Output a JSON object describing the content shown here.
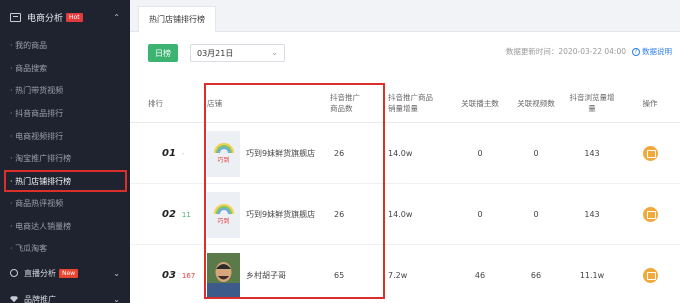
{
  "sidebar": {
    "header": {
      "label": "电商分析",
      "badge": "Hot"
    },
    "items": [
      {
        "label": "· 我的商品"
      },
      {
        "label": "· 商品搜索"
      },
      {
        "label": "· 热门带货视频"
      },
      {
        "label": "· 抖音商品排行"
      },
      {
        "label": "· 电商视频排行"
      },
      {
        "label": "· 淘宝推广排行榜"
      },
      {
        "label": "· 热门店铺排行榜"
      },
      {
        "label": "· 商品热评视频"
      },
      {
        "label": "· 电商达人销量榜"
      },
      {
        "label": "· 飞瓜淘客"
      }
    ],
    "active_index": 6,
    "groups": [
      {
        "label": "直播分析",
        "badge": "New"
      },
      {
        "label": "品牌推广"
      }
    ]
  },
  "tabbar": {
    "tab": "热门店铺排行榜"
  },
  "filters": {
    "period_button": "日榜",
    "date": "03月21日",
    "update_text": "数据更新时间：2020-03-22 04:00",
    "help_text": "数据说明"
  },
  "table": {
    "headers": {
      "rank": "排行",
      "shop": "店铺",
      "promo_count": "抖音推广\n商品数",
      "sales_increase": "抖音推广商品\n销量增量",
      "anchors": "关联播主数",
      "videos": "关联视频数",
      "views_increase": "抖音浏览量增\n量",
      "action": "操作"
    },
    "rows": [
      {
        "rank": "01",
        "delta": "-",
        "shop": "巧到9妹鲜货旗舰店",
        "promo_count": "26",
        "sales_increase": "14.0w",
        "anchors": "0",
        "videos": "0",
        "views_increase": "143"
      },
      {
        "rank": "02",
        "delta": "11",
        "shop": "巧到9妹鲜货旗舰店",
        "promo_count": "26",
        "sales_increase": "14.0w",
        "anchors": "0",
        "videos": "0",
        "views_increase": "143"
      },
      {
        "rank": "03",
        "delta": "167",
        "shop": "乡村胡子哥",
        "promo_count": "65",
        "sales_increase": "7.2w",
        "anchors": "46",
        "videos": "66",
        "views_increase": "11.1w"
      }
    ]
  },
  "colors": {
    "accent_green": "#3cb371",
    "highlight_red": "#d9302c",
    "action_orange": "#f0a93b",
    "sidebar_bg": "#1f2330"
  }
}
